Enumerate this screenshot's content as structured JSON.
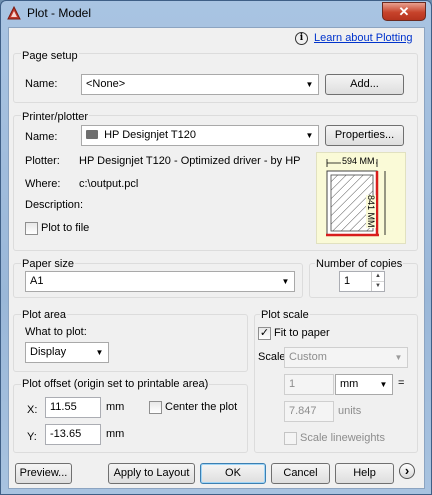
{
  "window": {
    "title": "Plot - Model",
    "close_glyph": "✕"
  },
  "help": {
    "icon": "info-icon",
    "glyph": "i",
    "link_label": "Learn about Plotting"
  },
  "page_setup": {
    "group_label": "Page setup",
    "name_label": "Name:",
    "name_value": "<None>",
    "add_button": "Add..."
  },
  "printer": {
    "group_label": "Printer/plotter",
    "name_label": "Name:",
    "name_value": "HP Designjet T120",
    "properties_button": "Properties...",
    "plotter_label": "Plotter:",
    "plotter_value": "HP Designjet T120 - Optimized driver - by HP",
    "where_label": "Where:",
    "where_value": "c:\\output.pcl",
    "description_label": "Description:",
    "plot_to_file_label": "Plot to file",
    "plot_to_file_checked": false,
    "preview_width_label": "594 MM",
    "preview_height_label": "841 MM"
  },
  "paper_size": {
    "group_label": "Paper size",
    "value": "A1"
  },
  "copies": {
    "group_label": "Number of copies",
    "value": "1"
  },
  "plot_area": {
    "group_label": "Plot area",
    "what_label": "What to plot:",
    "what_value": "Display"
  },
  "plot_offset": {
    "group_label": "Plot offset (origin set to printable area)",
    "x_label": "X:",
    "x_value": "11.55",
    "x_unit": "mm",
    "y_label": "Y:",
    "y_value": "-13.65",
    "y_unit": "mm",
    "center_label": "Center the plot",
    "center_checked": false
  },
  "plot_scale": {
    "group_label": "Plot scale",
    "fit_label": "Fit to paper",
    "fit_checked": true,
    "scale_label": "Scale:",
    "scale_value": "Custom",
    "num_value": "1",
    "unit_value": "mm",
    "equals": "=",
    "denom_value": "7.847",
    "denom_unit": "units",
    "lineweights_label": "Scale lineweights",
    "lineweights_checked": false
  },
  "footer": {
    "preview_button": "Preview...",
    "apply_button": "Apply to Layout",
    "ok_button": "OK",
    "cancel_button": "Cancel",
    "help_button": "Help",
    "expand_glyph": "›"
  },
  "colors": {
    "accent_link": "#0033cc",
    "paper_edge": "#d81c1c",
    "title_gradient": "#9ab7d8"
  }
}
